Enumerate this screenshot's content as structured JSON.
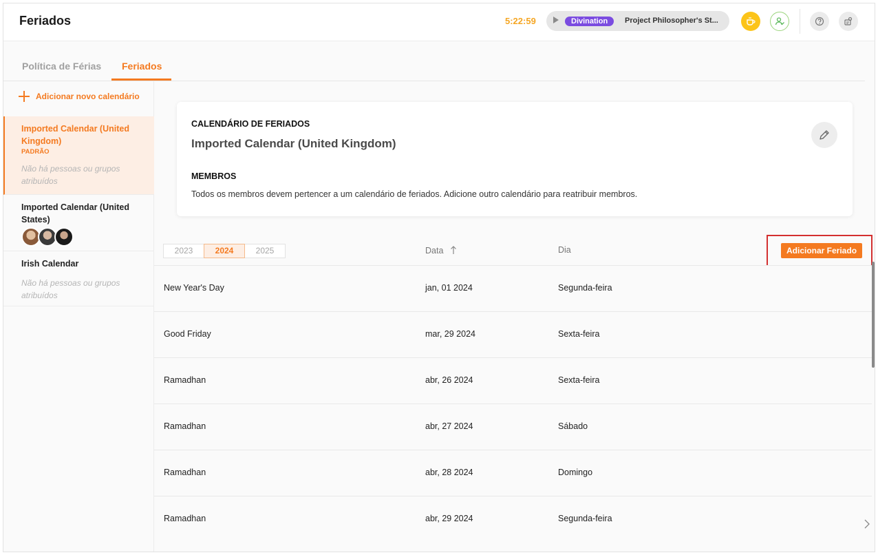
{
  "header": {
    "title": "Feriados",
    "timer": "5:22:59",
    "project_tag": "Divination",
    "project_name": "Project Philosopher's St..."
  },
  "tabs": [
    {
      "label": "Política de Férias",
      "active": false
    },
    {
      "label": "Feriados",
      "active": true
    }
  ],
  "sidebar": {
    "add_label": "Adicionar novo calendário",
    "calendars": [
      {
        "name": "Imported Calendar (United Kingdom)",
        "badge": "PADRÃO",
        "empty_text": "Não há pessoas ou grupos atribuídos",
        "active": true
      },
      {
        "name": "Imported Calendar (United States)",
        "avatars": 3,
        "active": false
      },
      {
        "name": "Irish Calendar",
        "empty_text": "Não há pessoas ou grupos atribuídos",
        "active": false
      }
    ]
  },
  "card": {
    "label": "CALENDÁRIO DE FERIADOS",
    "title": "Imported Calendar (United Kingdom)",
    "members_label": "MEMBROS",
    "members_text": "Todos os membros devem pertencer a um calendário de feriados. Adicione outro calendário para reatribuir membros."
  },
  "table": {
    "years": [
      "2023",
      "2024",
      "2025"
    ],
    "active_year": "2024",
    "col_data": "Data",
    "col_dia": "Dia",
    "add_button": "Adicionar Feriado",
    "rows": [
      {
        "name": "New Year's Day",
        "date": "jan, 01 2024",
        "day": "Segunda-feira"
      },
      {
        "name": "Good Friday",
        "date": "mar, 29 2024",
        "day": "Sexta-feira"
      },
      {
        "name": "Ramadhan",
        "date": "abr, 26 2024",
        "day": "Sexta-feira"
      },
      {
        "name": "Ramadhan",
        "date": "abr, 27 2024",
        "day": "Sábado"
      },
      {
        "name": "Ramadhan",
        "date": "abr, 28 2024",
        "day": "Domingo"
      },
      {
        "name": "Ramadhan",
        "date": "abr, 29 2024",
        "day": "Segunda-feira"
      }
    ]
  },
  "colors": {
    "accent": "#f47a20",
    "highlight": "#d32f2f",
    "tag": "#7b4ce0",
    "timer": "#f5a623"
  }
}
